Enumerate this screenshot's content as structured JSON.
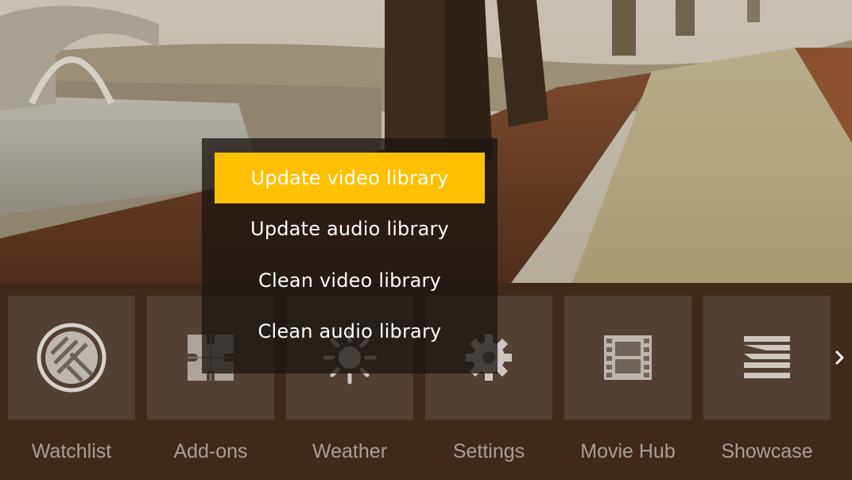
{
  "background": {
    "scene": "autumn park path with trees, stone bridge and fallen leaves"
  },
  "context_menu": {
    "items": [
      {
        "label": "Update video library",
        "focused": true
      },
      {
        "label": "Update audio library",
        "focused": false
      },
      {
        "label": "Clean video library",
        "focused": false
      },
      {
        "label": "Clean audio library",
        "focused": false
      }
    ],
    "focus_color": "#fec000"
  },
  "home_menu": {
    "tiles": [
      {
        "label": "Watchlist",
        "icon": "trakt-logo-icon"
      },
      {
        "label": "Add-ons",
        "icon": "puzzle-icon"
      },
      {
        "label": "Weather",
        "icon": "sun-icon"
      },
      {
        "label": "Settings",
        "icon": "gear-icon"
      },
      {
        "label": "Movie Hub",
        "icon": "film-strip-icon"
      },
      {
        "label": "Showcase",
        "icon": "showcase-icon"
      }
    ],
    "next_icon": "chevron-right-icon"
  }
}
